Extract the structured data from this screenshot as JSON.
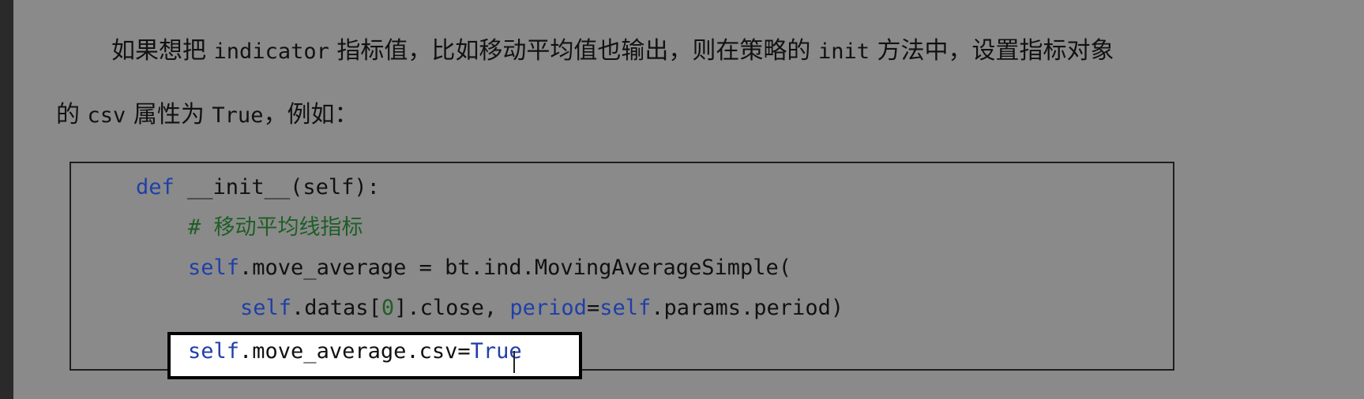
{
  "paragraph": {
    "line1_p1": "如果想把",
    "line1_code1": "indicator",
    "line1_p2": "指标值，比如移动平均值也输出，则在策略的",
    "line1_code2": "init",
    "line1_p3": "方法中，设置指标对象",
    "line2_p1": "的",
    "line2_code1": "csv",
    "line2_p2": "属性为",
    "line2_code2": "True",
    "line2_p3": "，例如："
  },
  "code": {
    "l1_def": "def",
    "l1_rest": " __init__(self):",
    "l2_comment": "# 移动平均线指标",
    "l3_self": "self",
    "l3_rest": ".move_average = bt.ind.MovingAverageSimple(",
    "l4_self": "self",
    "l4_mid1": ".datas[",
    "l4_idx": "0",
    "l4_mid2": "].close, ",
    "l4_param": "period",
    "l4_eq": "=",
    "l4_self2": "self",
    "l4_rest": ".params.period)",
    "l5_self": "self",
    "l5_mid": ".move_average.csv=",
    "l5_true": "True"
  },
  "colors": {
    "background": "#8a8a8a",
    "keyword": "#1f3fa8",
    "comment": "#1f5e26"
  }
}
